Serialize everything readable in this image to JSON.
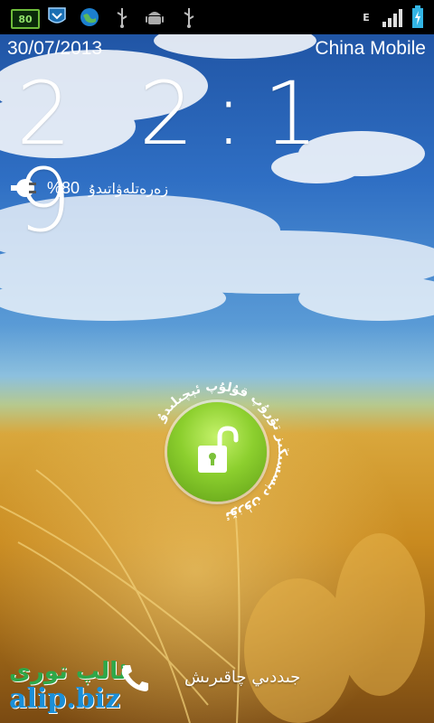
{
  "status_bar": {
    "battery_badge": "80",
    "network_type": "E",
    "icons": [
      "battery-80-icon",
      "shield-icon",
      "globe-icon",
      "usb-icon",
      "android-icon",
      "usb-icon",
      "data-arrows-icon",
      "signal-icon",
      "battery-charging-icon"
    ]
  },
  "lockscreen": {
    "date": "30/07/2013",
    "carrier": "China Mobile",
    "time_hours": "2 2",
    "time_minutes": "1 9",
    "charge_percent": "%80",
    "charge_text": "زەرەتلەۋاتىدۇ",
    "unlock_hint": "ئۆزۈن دېسسىڭىز تۇرۇپ قۇلۇپ ئېچىلىدۇ",
    "call_label": "جىددىي چاقىرىش",
    "accent_color": "#8ccf2e"
  },
  "watermark": {
    "brand_ug": "ئالپ تورى",
    "site": "alip.biz"
  }
}
